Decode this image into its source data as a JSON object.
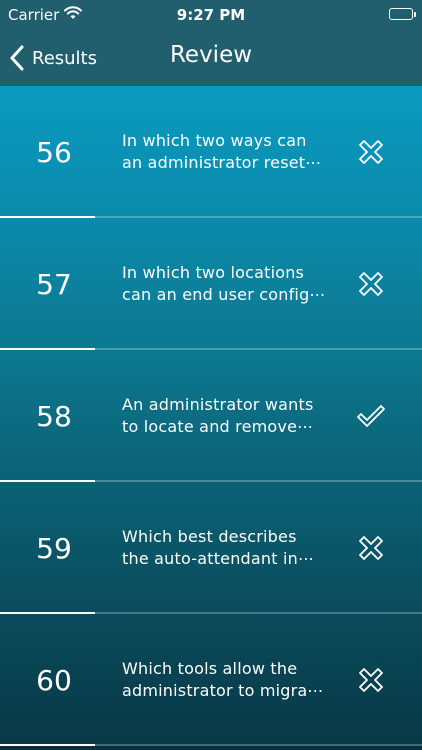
{
  "status_bar": {
    "carrier": "Carrier",
    "time": "9:27 PM"
  },
  "nav": {
    "back_label": "Results",
    "title": "Review"
  },
  "rows": [
    {
      "number": "56",
      "line1": "In which two ways can",
      "line2": "an administrator reset⋯",
      "result": "incorrect"
    },
    {
      "number": "57",
      "line1": "In which two locations",
      "line2": "can an end user config⋯",
      "result": "incorrect"
    },
    {
      "number": "58",
      "line1": "An administrator wants",
      "line2": "to locate and remove⋯",
      "result": "correct"
    },
    {
      "number": "59",
      "line1": "Which best describes",
      "line2": "the auto-attendant in⋯",
      "result": "incorrect"
    },
    {
      "number": "60",
      "line1": "Which tools allow the",
      "line2": "administrator to migra⋯",
      "result": "incorrect"
    }
  ],
  "colors": {
    "header": "#215e6e",
    "row_gradient": [
      "#0a9bc0",
      "#0b8aab",
      "#0c7890",
      "#0b6175",
      "#0a4b5c",
      "#083845"
    ]
  },
  "icons": {
    "incorrect": "x-icon",
    "correct": "checkmark-icon",
    "back": "chevron-left-icon",
    "wifi": "wifi-icon",
    "battery": "battery-icon"
  }
}
